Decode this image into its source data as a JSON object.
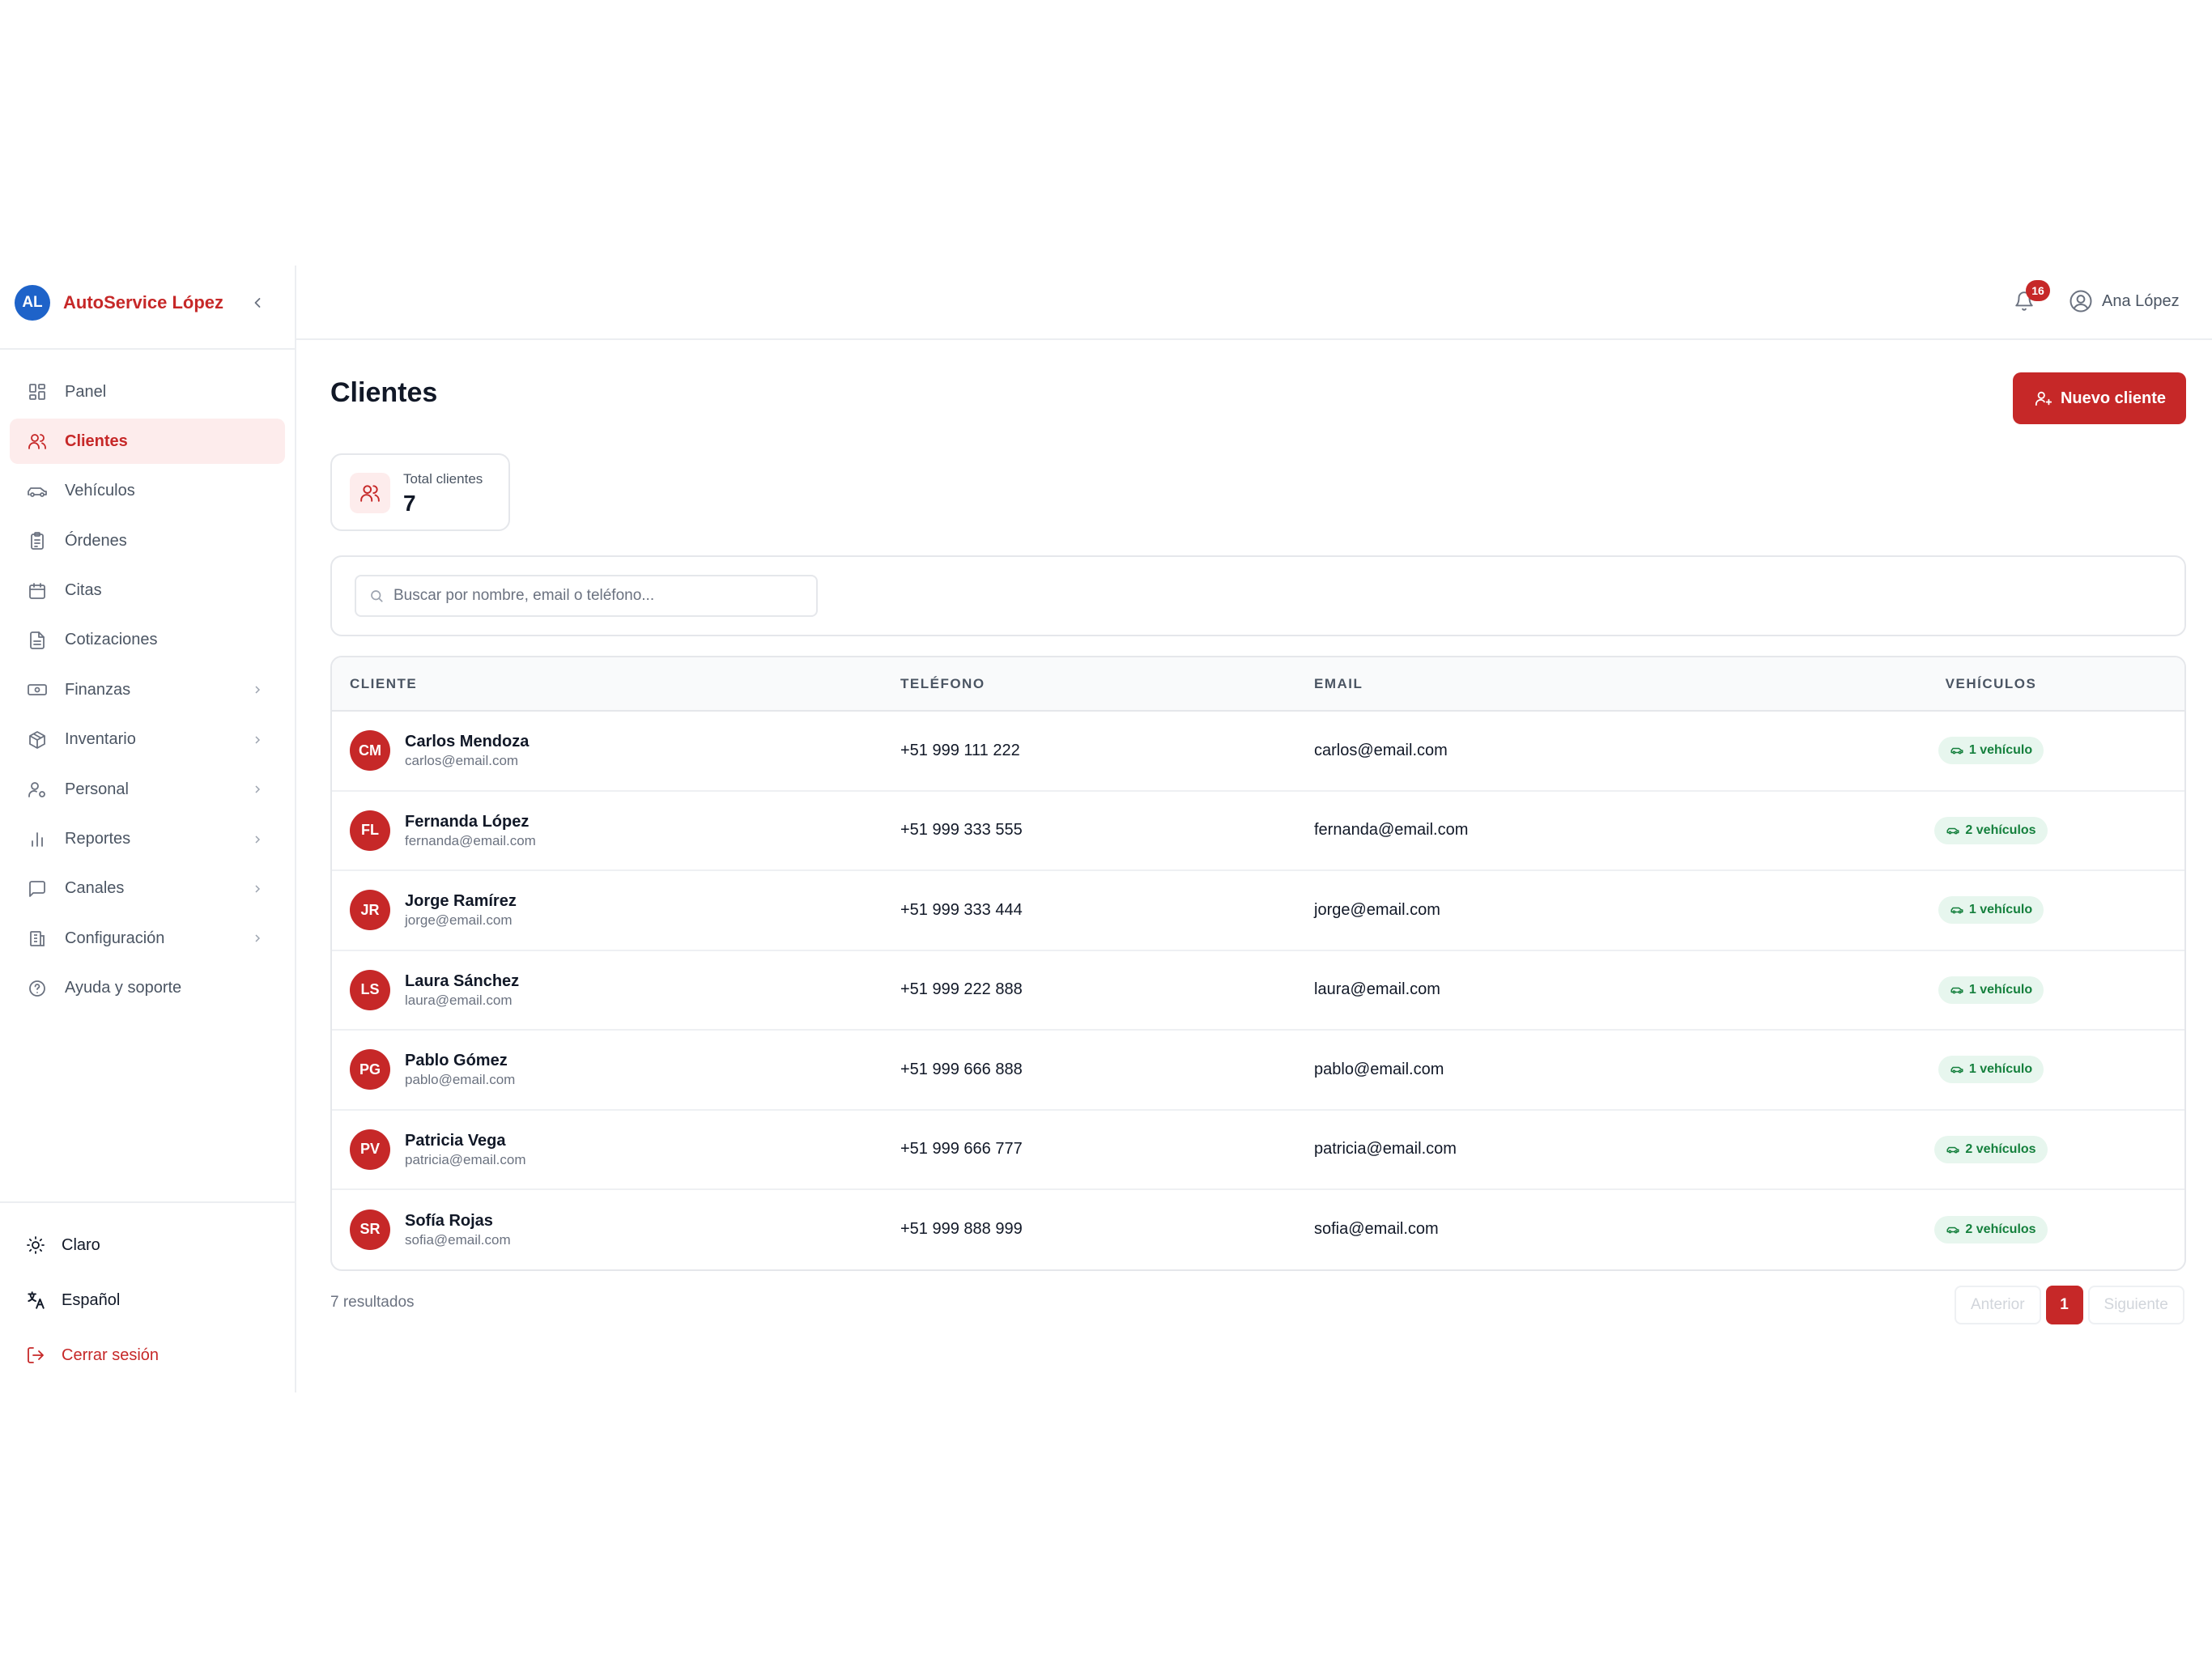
{
  "brand": {
    "initials": "AL",
    "name": "AutoService López"
  },
  "nav": {
    "items": [
      {
        "label": "Panel"
      },
      {
        "label": "Clientes"
      },
      {
        "label": "Vehículos"
      },
      {
        "label": "Órdenes"
      },
      {
        "label": "Citas"
      },
      {
        "label": "Cotizaciones"
      },
      {
        "label": "Finanzas"
      },
      {
        "label": "Inventario"
      },
      {
        "label": "Personal"
      },
      {
        "label": "Reportes"
      },
      {
        "label": "Canales"
      },
      {
        "label": "Configuración"
      },
      {
        "label": "Ayuda y soporte"
      }
    ],
    "active": "Clientes"
  },
  "sidebar_bottom": {
    "theme_label": "Claro",
    "language_label": "Español",
    "logout_label": "Cerrar sesión"
  },
  "header": {
    "notifications_count": "16",
    "user_name": "Ana López"
  },
  "page": {
    "title": "Clientes",
    "new_button_label": "Nuevo cliente"
  },
  "stats": {
    "total_label": "Total clientes",
    "total_value": "7"
  },
  "search": {
    "placeholder": "Buscar por nombre, email o teléfono...",
    "value": ""
  },
  "table": {
    "columns": {
      "cliente": "CLIENTE",
      "telefono": "TELÉFONO",
      "email": "EMAIL",
      "vehiculos": "VEHÍCULOS"
    },
    "rows": [
      {
        "initials": "CM",
        "name": "Carlos Mendoza",
        "email": "carlos@email.com",
        "phone": "+51 999 111 222",
        "vehicles": "1 vehículo"
      },
      {
        "initials": "FL",
        "name": "Fernanda López",
        "email": "fernanda@email.com",
        "phone": "+51 999 333 555",
        "vehicles": "2 vehículos"
      },
      {
        "initials": "JR",
        "name": "Jorge Ramírez",
        "email": "jorge@email.com",
        "phone": "+51 999 333 444",
        "vehicles": "1 vehículo"
      },
      {
        "initials": "LS",
        "name": "Laura Sánchez",
        "email": "laura@email.com",
        "phone": "+51 999 222 888",
        "vehicles": "1 vehículo"
      },
      {
        "initials": "PG",
        "name": "Pablo Gómez",
        "email": "pablo@email.com",
        "phone": "+51 999 666 888",
        "vehicles": "1 vehículo"
      },
      {
        "initials": "PV",
        "name": "Patricia Vega",
        "email": "patricia@email.com",
        "phone": "+51 999 666 777",
        "vehicles": "2 vehículos"
      },
      {
        "initials": "SR",
        "name": "Sofía Rojas",
        "email": "sofia@email.com",
        "phone": "+51 999 888 999",
        "vehicles": "2 vehículos"
      }
    ]
  },
  "footer": {
    "results_label": "7 resultados",
    "prev_label": "Anterior",
    "current_page": "1",
    "next_label": "Siguiente"
  },
  "colors": {
    "accent": "#c62828",
    "brand_avatar": "#1e63c9",
    "badge_bg": "#e7f6ee",
    "badge_text": "#15803d"
  },
  "icons": {
    "nav": [
      "dashboard-icon",
      "users-icon",
      "car-icon",
      "clipboard-icon",
      "calendar-icon",
      "document-icon",
      "banknote-icon",
      "package-icon",
      "user-cog-icon",
      "bar-chart-icon",
      "message-square-icon",
      "building-icon",
      "help-circle-icon"
    ],
    "bottom": [
      "sun-icon",
      "translate-icon",
      "logout-icon"
    ]
  }
}
